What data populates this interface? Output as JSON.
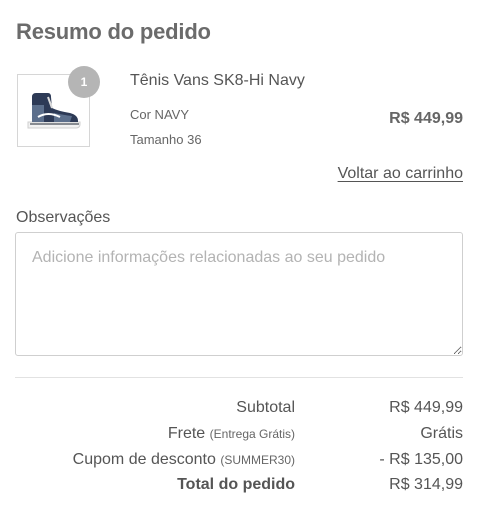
{
  "header": {
    "title": "Resumo do pedido"
  },
  "item": {
    "quantity": "1",
    "name": "Tênis Vans SK8-Hi Navy",
    "color_line": "Cor NAVY",
    "size_line": "Tamanho 36",
    "price": "R$ 449,99",
    "image_icon": "sneaker-image"
  },
  "links": {
    "back_to_cart": "Voltar ao carrinho"
  },
  "notes": {
    "label": "Observações",
    "placeholder": "Adicione informações relacionadas ao seu pedido"
  },
  "summary": {
    "subtotal_label": "Subtotal",
    "subtotal_value": "R$ 449,99",
    "shipping_label": "Frete",
    "shipping_note": "(Entrega Grátis)",
    "shipping_value": "Grátis",
    "coupon_label": "Cupom de desconto",
    "coupon_note": "(SUMMER30)",
    "coupon_value": "- R$ 135,00",
    "total_label": "Total do pedido",
    "total_value": "R$ 314,99"
  }
}
